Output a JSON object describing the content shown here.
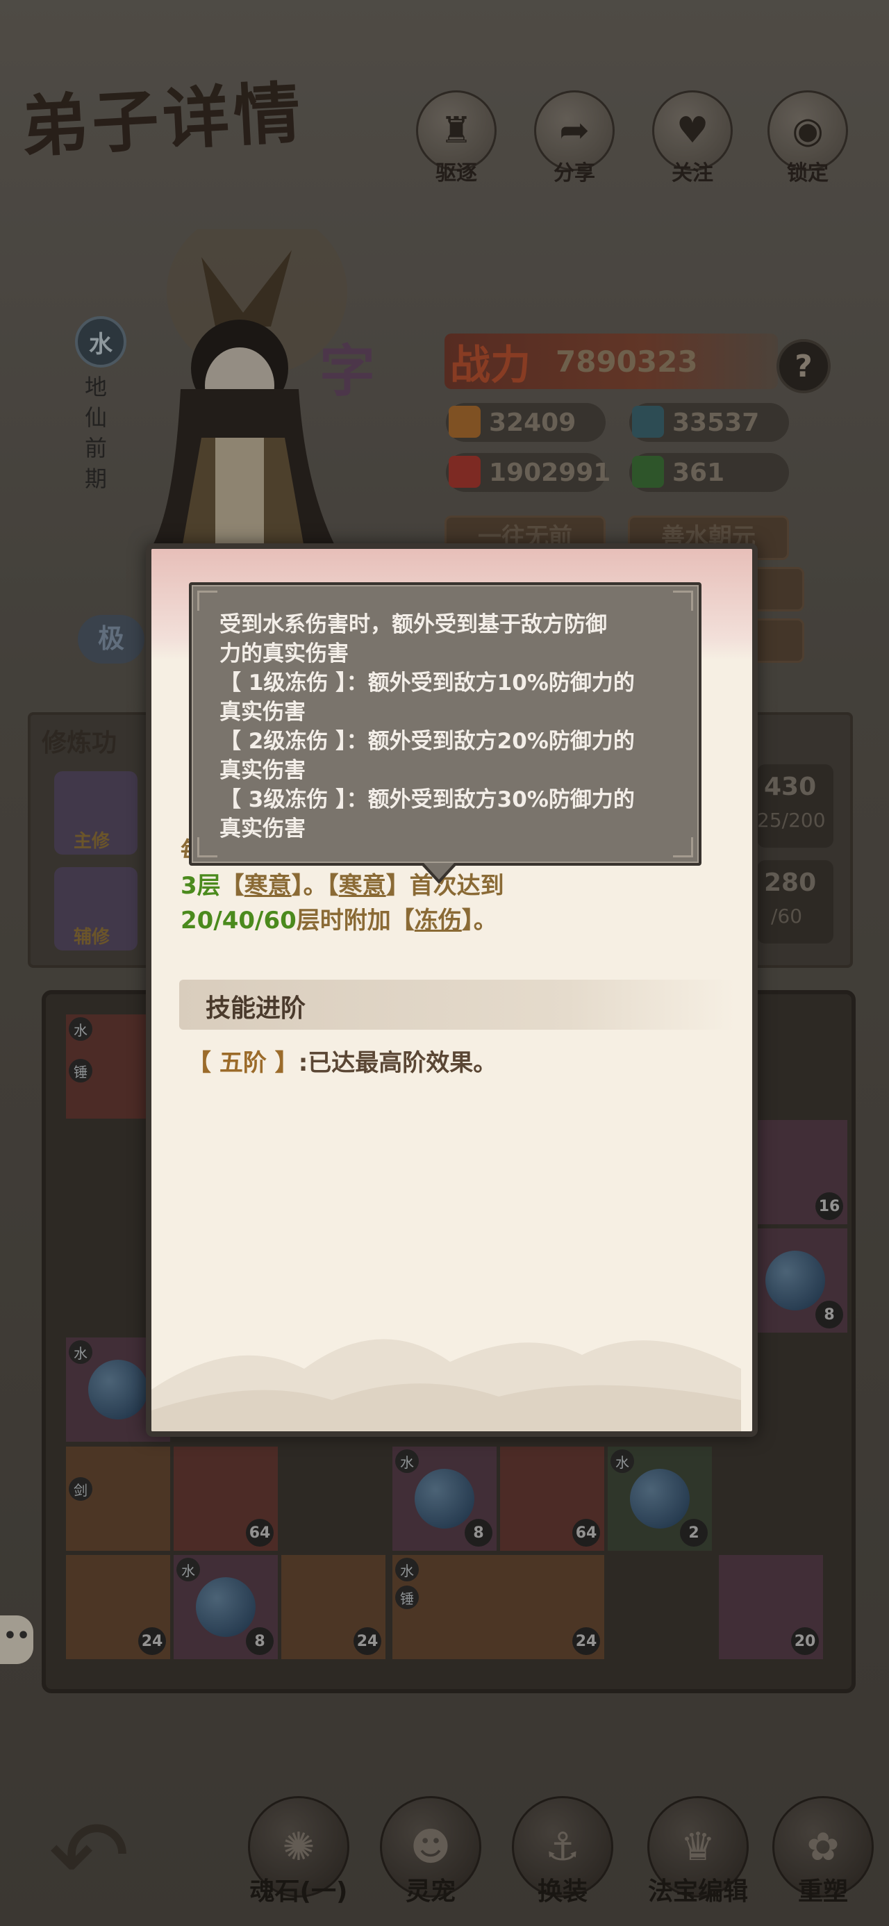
{
  "header": {
    "title": "弟子详情"
  },
  "top_actions": [
    {
      "label": "驱逐",
      "icon": "boot-icon"
    },
    {
      "label": "分享",
      "icon": "share-icon"
    },
    {
      "label": "关注",
      "icon": "heart-icon"
    },
    {
      "label": "锁定",
      "icon": "lock-icon"
    }
  ],
  "character": {
    "element": "水",
    "realm": "地仙前期",
    "name_fragment": "字"
  },
  "power": {
    "label": "战力",
    "value": "7890323",
    "help": "?"
  },
  "stats": [
    {
      "value": "32409",
      "icon": "sword-icon",
      "color": "#b8742f"
    },
    {
      "value": "33537",
      "icon": "shield-icon",
      "color": "#3b6c7a"
    },
    {
      "value": "1902991",
      "icon": "heart-icon",
      "color": "#b5382f"
    },
    {
      "value": "361",
      "icon": "book-icon",
      "color": "#3c7a3a"
    }
  ],
  "traits": [
    "一往无前",
    "善水朝元"
  ],
  "bg_text": {
    "cultivation": "修炼功",
    "main": "主修",
    "aux": "辅修",
    "v1": "430",
    "v1b": "25/200",
    "v2": "280",
    "v2b": "/60",
    "badge": "极"
  },
  "skill_popup": {
    "desc_line1_start": "每",
    "desc_line2_a": "3层",
    "desc_line2_b": "【",
    "desc_line2_kw1": "寒意",
    "desc_line2_c": "】。【",
    "desc_line2_kw2": "寒意",
    "desc_line2_d": "】首次达到",
    "desc_line3_nums": "20/40/60",
    "desc_line3_a": "层时附加【",
    "desc_line3_kw": "冻伤",
    "desc_line3_b": "】。",
    "section_title": "技能进阶",
    "advance_level": "【 五阶 】",
    "advance_text": ":已达最高阶效果。"
  },
  "tooltip": {
    "lines": [
      "受到水系伤害时，额外受到基于敌方防御",
      "力的真实伤害",
      "【 1级冻伤 】：额外受到敌方10%防御力的",
      "真实伤害",
      "【 2级冻伤 】：额外受到敌方20%防御力的",
      "真实伤害",
      "【 3级冻伤 】：额外受到敌方30%防御力的",
      "真实伤害"
    ]
  },
  "grid": {
    "cells": [
      {
        "badge": "水",
        "count": ""
      },
      {
        "badge": "锤",
        "count": ""
      },
      {
        "badge": "",
        "count": "16"
      },
      {
        "badge": "",
        "count": "8"
      },
      {
        "badge": "水",
        "count": ""
      },
      {
        "badge": "水",
        "count": "64"
      },
      {
        "badge": "水",
        "count": "8"
      },
      {
        "badge": "",
        "count": "64"
      },
      {
        "badge": "水",
        "count": "2"
      },
      {
        "badge": "",
        "count": "24"
      },
      {
        "badge": "水",
        "count": "8"
      },
      {
        "badge": "",
        "count": "24"
      },
      {
        "badge": "水",
        "count": "24"
      },
      {
        "badge": "",
        "count": "20"
      }
    ],
    "sub_badges": {
      "sword": "剑",
      "hammer": "锤"
    }
  },
  "bottom_nav": [
    {
      "label": "魂石(一)",
      "icon": "soul-stone-icon"
    },
    {
      "label": "灵宠",
      "icon": "pet-icon"
    },
    {
      "label": "换装",
      "icon": "outfit-icon"
    },
    {
      "label": "法宝编辑",
      "icon": "treasure-icon"
    },
    {
      "label": "重塑",
      "icon": "reshape-icon"
    }
  ],
  "chat": {
    "label": "••"
  }
}
